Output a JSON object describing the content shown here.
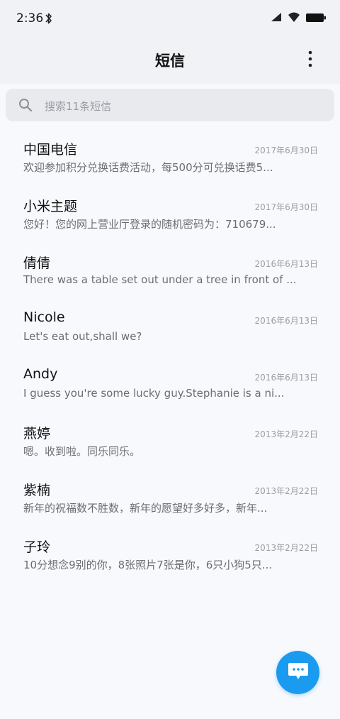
{
  "status_bar": {
    "time": "2:36"
  },
  "header": {
    "title": "短信"
  },
  "search": {
    "placeholder": "搜索11条短信"
  },
  "messages": [
    {
      "name": "中国电信",
      "date": "2017年6月30日",
      "preview": "欢迎参加积分兑换话费活动，每500分可兑换话费5..."
    },
    {
      "name": "小米主题",
      "date": "2017年6月30日",
      "preview": "您好！您的网上营业厅登录的随机密码为：710679..."
    },
    {
      "name": "倩倩",
      "date": "2016年6月13日",
      "preview": "There was a table set out under a tree in front of ..."
    },
    {
      "name": "Nicole",
      "date": "2016年6月13日",
      "preview": "Let's eat out,shall we?"
    },
    {
      "name": "Andy",
      "date": "2016年6月13日",
      "preview": "I guess you're some lucky guy.Stephanie is a ni..."
    },
    {
      "name": "燕婷",
      "date": "2013年2月22日",
      "preview": "嗯。收到啦。同乐同乐。"
    },
    {
      "name": "紫楠",
      "date": "2013年2月22日",
      "preview": "新年的祝福数不胜数，新年的愿望好多好多，新年..."
    },
    {
      "name": "子玲",
      "date": "2013年2月22日",
      "preview": "10分想念9别的你，8张照片7张是你，6只小狗5只..."
    }
  ],
  "colors": {
    "accent": "#1a9bf0",
    "background": "#f8f9fd",
    "header_bg": "#f1f2f6"
  },
  "icons": {
    "bluetooth": "bluetooth-icon",
    "signal": "signal-icon",
    "wifi": "wifi-icon",
    "battery": "battery-icon",
    "more": "more-vertical-icon",
    "search": "search-icon",
    "compose": "chat-bubble-icon"
  }
}
